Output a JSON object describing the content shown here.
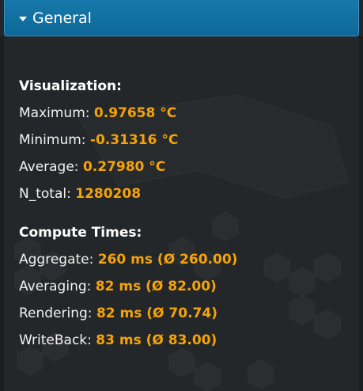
{
  "header": {
    "title": "General"
  },
  "visualization": {
    "title": "Visualization:",
    "rows": [
      {
        "label": "Maximum:",
        "value": "0.97658 °C"
      },
      {
        "label": "Minimum:",
        "value": "-0.31316 °C"
      },
      {
        "label": "Average:",
        "value": "0.27980 °C"
      },
      {
        "label": "N_total:",
        "value": "1280208"
      }
    ]
  },
  "compute_times": {
    "title": "Compute Times:",
    "rows": [
      {
        "label": "Aggregate:",
        "value": "260 ms (Ø 260.00)"
      },
      {
        "label": "Averaging:",
        "value": "82 ms (Ø 82.00)"
      },
      {
        "label": "Rendering:",
        "value": "82 ms (Ø 70.74)"
      },
      {
        "label": "WriteBack:",
        "value": "83 ms (Ø 83.00)"
      }
    ]
  },
  "colors": {
    "header": "#1779ab",
    "value": "#f5a30a",
    "background": "#242729",
    "text": "#f2f2f2"
  }
}
